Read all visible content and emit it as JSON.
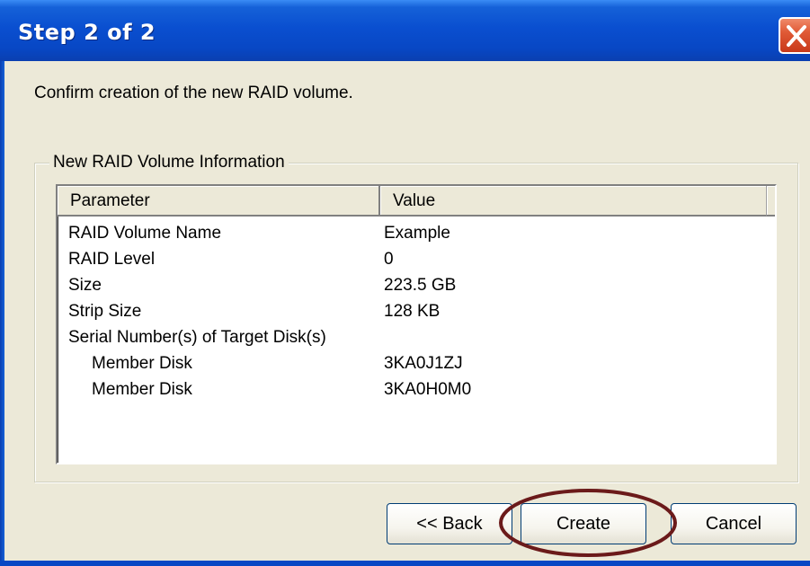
{
  "dialog": {
    "title": "Step 2 of 2",
    "prompt": "Confirm creation of the new RAID volume.",
    "group_label": "New RAID Volume Information"
  },
  "table": {
    "columns": [
      "Parameter",
      "Value"
    ],
    "rows": [
      {
        "parameter": "RAID Volume Name",
        "value": "Example"
      },
      {
        "parameter": "RAID Level",
        "value": "0"
      },
      {
        "parameter": "Size",
        "value": "223.5 GB"
      },
      {
        "parameter": "Strip Size",
        "value": "128 KB"
      },
      {
        "parameter": "Serial Number(s) of Target Disk(s)",
        "value": ""
      },
      {
        "parameter": "Member Disk",
        "value": "3KA0J1ZJ"
      },
      {
        "parameter": "Member Disk",
        "value": "3KA0H0M0"
      }
    ]
  },
  "buttons": {
    "back": "<< Back",
    "create": "Create",
    "cancel": "Cancel"
  },
  "colors": {
    "titlebar": "#0a4fd0",
    "dialog_background": "#ece9d8",
    "highlight_ring": "#6b1a1a",
    "close_button": "#e05a36"
  },
  "icons": {
    "close": "close-icon"
  }
}
